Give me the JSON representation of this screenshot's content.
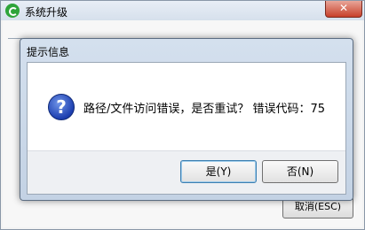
{
  "parent_window": {
    "title": "系统升级",
    "close_label": "✕",
    "cancel_label": "取消(ESC)"
  },
  "dialog": {
    "title": "提示信息",
    "icon": "question-icon",
    "message": "路径/文件访问错误，是否重试？  错误代码：75",
    "yes_label": "是(Y)",
    "no_label": "否(N)"
  }
}
